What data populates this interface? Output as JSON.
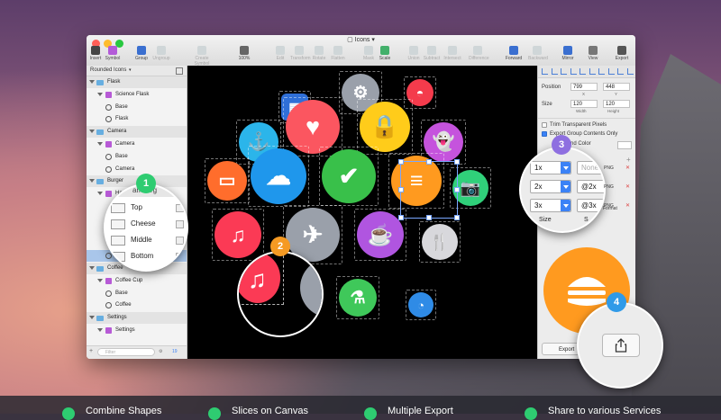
{
  "window": {
    "title": "Icons",
    "doc_icon": "sketch-doc-icon"
  },
  "toolbar": {
    "items": [
      {
        "label": "Insert",
        "icon": "plus-icon",
        "dim": false
      },
      {
        "label": "Symbol",
        "icon": "symbol-icon",
        "dim": false
      },
      {
        "label": "Group",
        "icon": "group-icon",
        "dim": false
      },
      {
        "label": "Ungroup",
        "icon": "ungroup-icon",
        "dim": true
      },
      {
        "label": "Create Symbol",
        "icon": "create-symbol-icon",
        "dim": true
      },
      {
        "label": "100%",
        "icon": "zoom-icon",
        "dim": false
      },
      {
        "label": "Edit",
        "icon": "edit-icon",
        "dim": true
      },
      {
        "label": "Transform",
        "icon": "transform-icon",
        "dim": true
      },
      {
        "label": "Rotate",
        "icon": "rotate-icon",
        "dim": true
      },
      {
        "label": "Flatten",
        "icon": "flatten-icon",
        "dim": true
      },
      {
        "label": "Mask",
        "icon": "mask-icon",
        "dim": true
      },
      {
        "label": "Scale",
        "icon": "scale-icon",
        "dim": false
      },
      {
        "label": "Union",
        "icon": "union-icon",
        "dim": true
      },
      {
        "label": "Subtract",
        "icon": "subtract-icon",
        "dim": true
      },
      {
        "label": "Intersect",
        "icon": "intersect-icon",
        "dim": true
      },
      {
        "label": "Difference",
        "icon": "difference-icon",
        "dim": true
      },
      {
        "label": "Forward",
        "icon": "forward-icon",
        "dim": false
      },
      {
        "label": "Backward",
        "icon": "backward-icon",
        "dim": true
      },
      {
        "label": "Mirror",
        "icon": "mirror-icon",
        "dim": false
      },
      {
        "label": "View",
        "icon": "view-icon",
        "dim": false
      },
      {
        "label": "Export",
        "icon": "export-icon",
        "dim": false
      }
    ]
  },
  "sidebar": {
    "page_selector": "Rounded Icons",
    "rows": [
      {
        "text": "Flask",
        "kind": "group",
        "indent": 0
      },
      {
        "text": "Science Flask",
        "kind": "layer",
        "indent": 1
      },
      {
        "text": "Base",
        "kind": "shape",
        "indent": 1
      },
      {
        "text": "Flask",
        "kind": "shape",
        "indent": 1
      },
      {
        "text": "Camera",
        "kind": "group",
        "indent": 0
      },
      {
        "text": "Camera",
        "kind": "layer",
        "indent": 1
      },
      {
        "text": "Base",
        "kind": "shape",
        "indent": 1
      },
      {
        "text": "Camera",
        "kind": "shape",
        "indent": 1
      },
      {
        "text": "Burger",
        "kind": "group",
        "indent": 0
      },
      {
        "text": "Hamburger",
        "kind": "layer",
        "indent": 1
      },
      {
        "text": "",
        "kind": "blank",
        "indent": 1
      },
      {
        "text": "",
        "kind": "blank",
        "indent": 1
      },
      {
        "text": "",
        "kind": "blank",
        "indent": 1
      },
      {
        "text": "",
        "kind": "blank",
        "indent": 1
      },
      {
        "text": "Burger",
        "kind": "selected",
        "indent": 1
      },
      {
        "text": "Coffee",
        "kind": "group",
        "indent": 0
      },
      {
        "text": "Coffee Cup",
        "kind": "layer",
        "indent": 1
      },
      {
        "text": "Base",
        "kind": "shape",
        "indent": 1
      },
      {
        "text": "Coffee",
        "kind": "shape",
        "indent": 1
      },
      {
        "text": "Settings",
        "kind": "group",
        "indent": 0
      },
      {
        "text": "Settings",
        "kind": "layer",
        "indent": 1
      }
    ],
    "filter_placeholder": "Filter",
    "footer_count": "19"
  },
  "lens1": {
    "rows": [
      "Top",
      "Cheese",
      "Middle",
      "Bottom"
    ],
    "header_partial": "amburg",
    "badge": "1"
  },
  "lens2": {
    "badge": "2"
  },
  "lens3": {
    "rows": [
      {
        "scale": "1x",
        "suffix": "None",
        "format": "PNG"
      },
      {
        "scale": "2x",
        "suffix": "@2x",
        "format": "PNG"
      },
      {
        "scale": "3x",
        "suffix": "@3x",
        "format": "PNG"
      }
    ],
    "size_label": "Size",
    "suffix_label": "S",
    "format_label": "Format",
    "badge": "3"
  },
  "lens4": {
    "badge": "4",
    "icon": "share-icon"
  },
  "inspector": {
    "position_label": "Position",
    "x": "799",
    "y": "448",
    "x_label": "X",
    "y_label": "Y",
    "size_label": "Size",
    "width": "120",
    "height": "120",
    "width_label": "Width",
    "height_label": "Height",
    "trim_label": "Trim Transparent Pixels",
    "export_group_label": "Export Group Contents Only",
    "bg_color_label": "nd Color",
    "export_button": "Export"
  },
  "canvas_icons": [
    {
      "name": "film-icon",
      "color": "#2f6fd8",
      "glyph": "▦"
    },
    {
      "name": "gear-icon",
      "color": "#9aa0aa",
      "glyph": "⚙"
    },
    {
      "name": "watermelon-icon",
      "color": "#f43b4c",
      "glyph": "◓"
    },
    {
      "name": "anchor-icon",
      "color": "#2bb5ea",
      "glyph": "⚓"
    },
    {
      "name": "heart-icon",
      "color": "#fb5660",
      "glyph": "♥"
    },
    {
      "name": "lock-icon",
      "color": "#ffcc1a",
      "glyph": "🔒"
    },
    {
      "name": "ghost-icon",
      "color": "#c553dd",
      "glyph": "👻"
    },
    {
      "name": "battery-icon",
      "color": "#ff6d2c",
      "glyph": "▭"
    },
    {
      "name": "cloud-icon",
      "color": "#1f97ec",
      "glyph": "☁"
    },
    {
      "name": "checkmark-icon",
      "color": "#39c04a",
      "glyph": "✔"
    },
    {
      "name": "hamburger-icon",
      "color": "#ff9a1f",
      "glyph": "≡"
    },
    {
      "name": "camera-icon",
      "color": "#30d07a",
      "glyph": "📷"
    },
    {
      "name": "music-note-icon",
      "color": "#fb3a55",
      "glyph": "♫"
    },
    {
      "name": "airplane-icon",
      "color": "#9aa0aa",
      "glyph": "✈"
    },
    {
      "name": "coffee-cup-icon",
      "color": "#b055e0",
      "glyph": "☕"
    },
    {
      "name": "fork-knife-icon",
      "color": "#d8d8dc",
      "glyph": "🍴"
    },
    {
      "name": "flask-icon",
      "color": "#3fc85a",
      "glyph": "⚗"
    },
    {
      "name": "pie-chart-icon",
      "color": "#2f8be6",
      "glyph": "◔"
    },
    {
      "name": "partial-yellow-icon",
      "color": "#ffcc1a",
      "glyph": ""
    }
  ],
  "features": [
    {
      "text": "Combine Shapes"
    },
    {
      "text": "Slices on Canvas"
    },
    {
      "text": "Multiple Export"
    },
    {
      "text": "Share to various Services"
    }
  ],
  "colors": {
    "accent": "#3b82f6",
    "badge_green": "#2ecc71",
    "badge_orange": "#f59a23",
    "badge_purple": "#8e6fe0",
    "badge_blue": "#2f9ae8"
  }
}
